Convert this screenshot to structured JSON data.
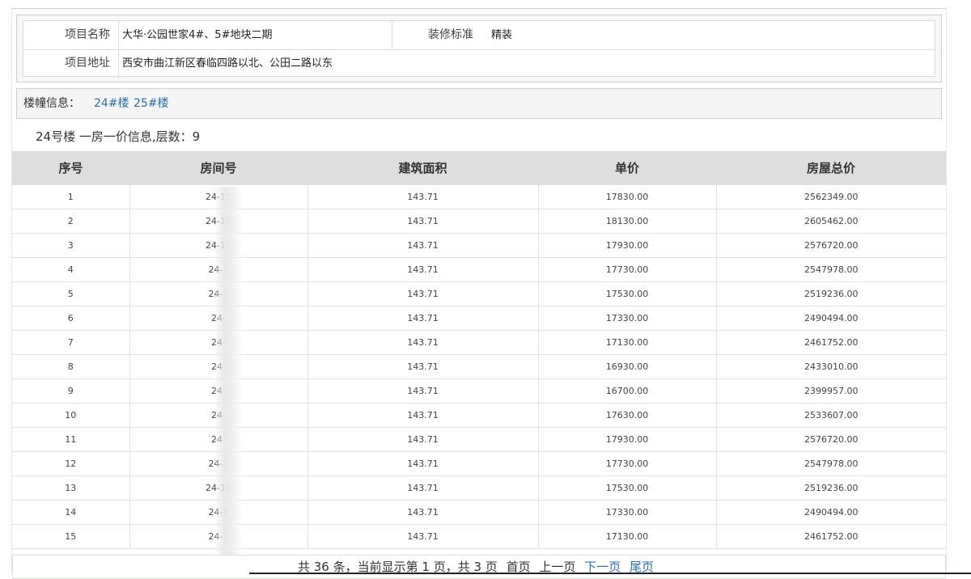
{
  "project": {
    "name_label": "项目名称",
    "name_value": "大华·公园世家4#、5#地块二期",
    "decoration_label": "装修标准",
    "decoration_value": "精装",
    "address_label": "项目地址",
    "address_value": "西安市曲江新区春临四路以北、公田二路以东"
  },
  "buildings": {
    "label": "楼幢信息：",
    "items": [
      "24#楼",
      "25#楼"
    ]
  },
  "summary": "24号楼 一房一价信息,层数：9",
  "table": {
    "headers": [
      "序号",
      "房间号",
      "建筑面积",
      "单价",
      "房屋总价"
    ],
    "rows": [
      [
        "1",
        "24-10",
        "143.71",
        "17830.00",
        "2562349.00"
      ],
      [
        "2",
        "24-10",
        "143.71",
        "18130.00",
        "2605462.00"
      ],
      [
        "3",
        "24-10",
        "143.71",
        "17930.00",
        "2576720.00"
      ],
      [
        "4",
        "24-1",
        "143.71",
        "17730.00",
        "2547978.00"
      ],
      [
        "5",
        "24-1",
        "143.71",
        "17530.00",
        "2519236.00"
      ],
      [
        "6",
        "24-",
        "143.71",
        "17330.00",
        "2490494.00"
      ],
      [
        "7",
        "24-",
        "143.71",
        "17130.00",
        "2461752.00"
      ],
      [
        "8",
        "24-",
        "143.71",
        "16930.00",
        "2433010.00"
      ],
      [
        "9",
        "24-",
        "143.71",
        "16700.00",
        "2399957.00"
      ],
      [
        "10",
        "24-",
        "143.71",
        "17630.00",
        "2533607.00"
      ],
      [
        "11",
        "24-",
        "143.71",
        "17930.00",
        "2576720.00"
      ],
      [
        "12",
        "24-1",
        "143.71",
        "17730.00",
        "2547978.00"
      ],
      [
        "13",
        "24-10",
        "143.71",
        "17530.00",
        "2519236.00"
      ],
      [
        "14",
        "24-1",
        "143.71",
        "17330.00",
        "2490494.00"
      ],
      [
        "15",
        "24-1",
        "143.71",
        "17130.00",
        "2461752.00"
      ]
    ]
  },
  "pager": {
    "total": "共 36 条，当前显示第 1 页，共 3 页",
    "first": "首页",
    "prev": "上一页",
    "next": "下一页",
    "last": "尾页"
  }
}
